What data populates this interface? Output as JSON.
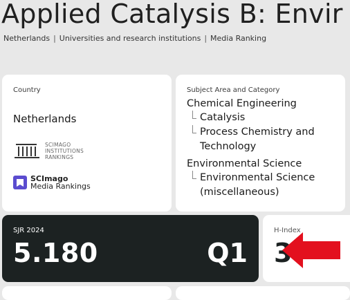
{
  "journal": {
    "title": "Applied Catalysis B: Envir"
  },
  "breadcrumb": {
    "items": [
      "Netherlands",
      "Universities and research institutions",
      "Media Ranking"
    ],
    "separator": "|"
  },
  "country": {
    "label": "Country",
    "name": "Netherlands",
    "institutions_logo": {
      "line1": "SCIMAGO",
      "line2": "INSTITUTIONS",
      "line3": "RANKINGS"
    },
    "media_logo": {
      "line1": "SCImago",
      "line2": "Media Rankings"
    }
  },
  "subject": {
    "label": "Subject Area and Category",
    "areas": [
      {
        "name": "Chemical Engineering",
        "categories": [
          "Catalysis",
          "Process Chemistry and Technology"
        ]
      },
      {
        "name": "Environmental Science",
        "categories": [
          "Environmental Science (miscellaneous)"
        ]
      }
    ]
  },
  "sjr": {
    "label": "SJR 2024",
    "value": "5.180",
    "quartile": "Q1"
  },
  "hindex": {
    "label": "H-Index",
    "value": "3"
  },
  "colors": {
    "background": "#e8e8e8",
    "dark_card": "#1c2222",
    "arrow": "#e3101e",
    "media_icon": "#5b4ccf"
  }
}
